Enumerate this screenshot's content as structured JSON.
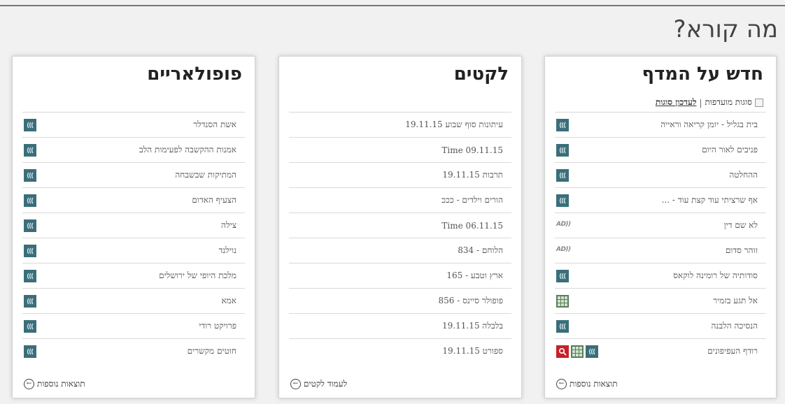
{
  "page": {
    "title": "מה קורא?"
  },
  "panels": {
    "new": {
      "title": "חדש על המדף",
      "filter": {
        "preferred_label": "סוגות מועדפות",
        "separator": "|",
        "update_label": "לעדכון סוגות"
      },
      "items": [
        {
          "label": "בית בגליל - יומן קריאה וראייה",
          "icons": [
            "audio"
          ]
        },
        {
          "label": "פניבים לאור היום",
          "icons": [
            "audio"
          ]
        },
        {
          "label": "ההחלטה",
          "icons": [
            "audio"
          ]
        },
        {
          "label": "אף שרציתי עוד קצת עוד - ...",
          "icons": [
            "audio"
          ]
        },
        {
          "label": "לא שם דין",
          "icons": [
            "ad"
          ]
        },
        {
          "label": "זוהר סדום",
          "icons": [
            "ad"
          ]
        },
        {
          "label": "סודותיה של רומינה לוקאס",
          "icons": [
            "audio"
          ]
        },
        {
          "label": "אל תגע בזמיר",
          "icons": [
            "grid"
          ]
        },
        {
          "label": "הנסיכה הלבנה",
          "icons": [
            "audio"
          ]
        },
        {
          "label": "רודף העפיפונים",
          "icons": [
            "audio",
            "grid",
            "search"
          ]
        }
      ],
      "more_label": "תוצאות נוספות"
    },
    "clips": {
      "title": "לקטים",
      "items": [
        {
          "label": "עיתונות סוף שבוע 19.11.15"
        },
        {
          "label": "Time 09.11.15"
        },
        {
          "label": "תרבות 19.11.15"
        },
        {
          "label": "הורים וילדים - כככ"
        },
        {
          "label": "Time 06.11.15"
        },
        {
          "label": "הלוחם - 834"
        },
        {
          "label": "ארץ וטבע - 165"
        },
        {
          "label": "פופולר סיינס - 856"
        },
        {
          "label": "בלבלה 19.11.15"
        },
        {
          "label": "ספורט 19.11.15"
        }
      ],
      "more_label": "לעמוד לקטים"
    },
    "popular": {
      "title": "פופולאריים",
      "items": [
        {
          "label": "אשת הסנדלר",
          "icons": [
            "audio"
          ]
        },
        {
          "label": "אמנות ההקשבה לפעימות הלב",
          "icons": [
            "audio"
          ]
        },
        {
          "label": "המתיקות שבשבחה",
          "icons": [
            "audio"
          ]
        },
        {
          "label": "הצעיף האדום",
          "icons": [
            "audio"
          ]
        },
        {
          "label": "צילה",
          "icons": [
            "audio"
          ]
        },
        {
          "label": "נוילנד",
          "icons": [
            "audio"
          ]
        },
        {
          "label": "מלכת היופי של ירושלים",
          "icons": [
            "audio"
          ]
        },
        {
          "label": "אמא",
          "icons": [
            "audio"
          ]
        },
        {
          "label": "פרויקט רודי",
          "icons": [
            "audio"
          ]
        },
        {
          "label": "חוטים מקשרים",
          "icons": [
            "audio"
          ]
        }
      ],
      "more_label": "תוצאות נוספות"
    }
  },
  "colors": {
    "audio_icon_bg": "#3a6e7a",
    "grid_icon_bg": "#5a7d5a",
    "search_icon_bg": "#c8202a"
  },
  "icon_names": {
    "audio": "audio-wave-icon",
    "grid": "grid-icon",
    "search": "search-icon",
    "ad": "audio-description-icon",
    "more": "arrow-left-circle-icon"
  }
}
